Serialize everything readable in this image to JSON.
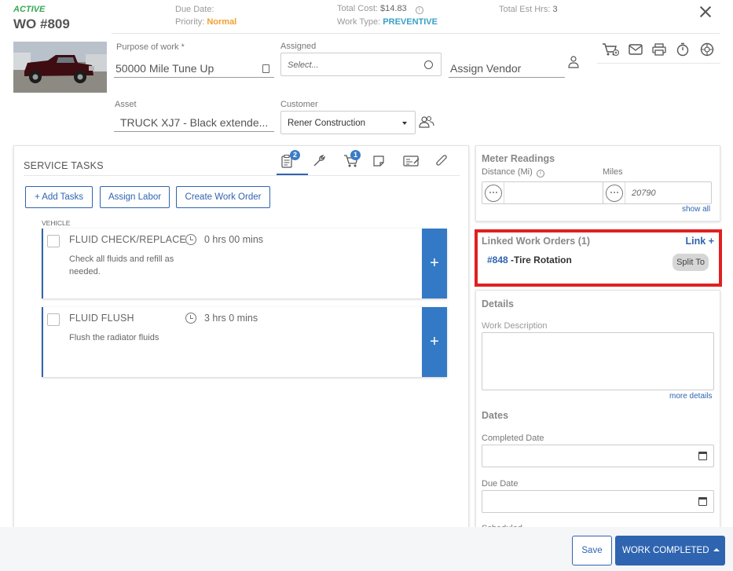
{
  "header": {
    "status": "ACTIVE",
    "wo_number": "WO #809",
    "due_date_label": "Due Date:",
    "priority_label": "Priority:",
    "priority_value": "Normal",
    "total_cost_label": "Total Cost:",
    "total_cost_value": "$14.83",
    "work_type_label": "Work Type:",
    "work_type_value": "PREVENTIVE",
    "total_est_label": "Total Est Hrs:",
    "total_est_value": "3"
  },
  "form": {
    "purpose_label": "Purpose of work *",
    "purpose_value": "50000 Mile Tune Up",
    "assigned_label": "Assigned",
    "assigned_placeholder": "Select...",
    "assign_vendor": "Assign Vendor",
    "asset_label": "Asset",
    "asset_value": "TRUCK XJ7 - Black extende...",
    "customer_label": "Customer",
    "customer_value": "Rener Construction"
  },
  "service": {
    "title": "SERVICE TASKS",
    "tab_tasks_badge": "2",
    "tab_parts_badge": "1",
    "add_tasks": "+ Add Tasks",
    "assign_labor": "Assign Labor",
    "create_work_order": "Create Work Order",
    "group_label": "VEHICLE",
    "tasks": [
      {
        "name": "FLUID CHECK/REPLACE",
        "time": "0 hrs 00 mins",
        "desc": "Check all fluids and refill as needed."
      },
      {
        "name": "FLUID FLUSH",
        "time": "3 hrs 0 mins",
        "desc": "Flush the radiator fluids"
      }
    ]
  },
  "meter": {
    "title": "Meter Readings",
    "distance_label": "Distance (Mi)",
    "miles_label": "Miles",
    "miles_value": "20790",
    "show_all": "show all"
  },
  "linked": {
    "title": "Linked Work Orders (1)",
    "link_button": "Link +",
    "order_number": "#848",
    "order_name": "-Tire Rotation",
    "split_to": "Split To"
  },
  "details": {
    "title": "Details",
    "work_description_label": "Work Description",
    "more_details": "more details"
  },
  "dates": {
    "title": "Dates",
    "completed_label": "Completed Date",
    "due_label": "Due Date",
    "scheduled_label": "Scheduled"
  },
  "footer": {
    "save": "Save",
    "work_completed": "WORK COMPLETED"
  },
  "colors": {
    "accent": "#2f64b0",
    "active_green": "#36a853",
    "priority_orange": "#f0a030",
    "work_type_teal": "#3aa0c8",
    "highlight_red": "#e02020"
  }
}
